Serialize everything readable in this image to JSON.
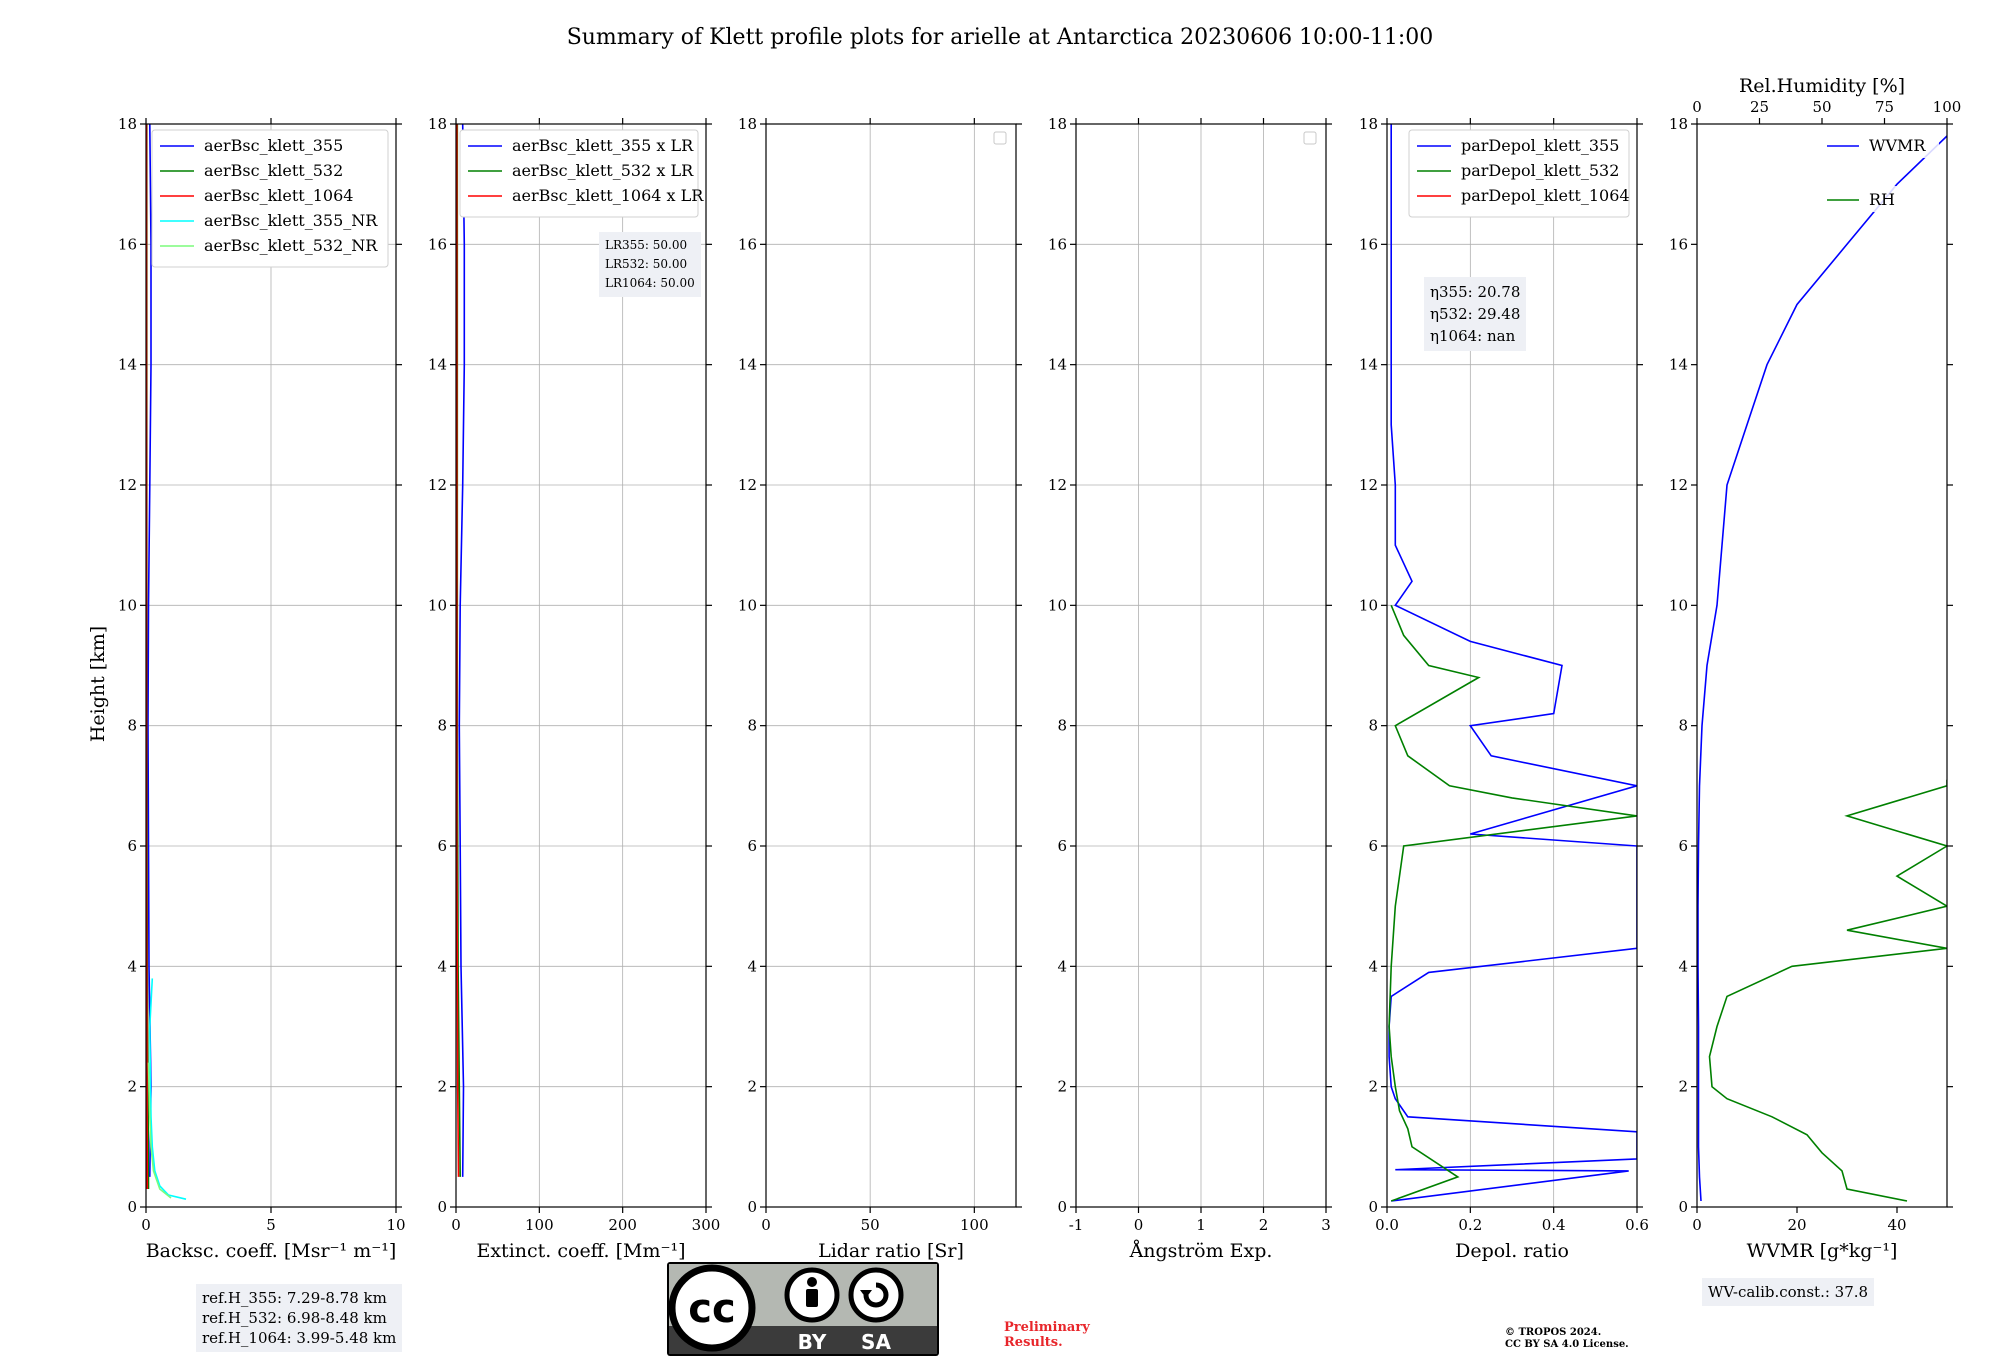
{
  "figure": {
    "title": "Summary of Klett profile plots for arielle at Antarctica 20230606 10:00-11:00",
    "ylabel": "Height [km]"
  },
  "colors": {
    "blue": "#0000ff",
    "green": "#008000",
    "red": "#ff0000",
    "cyan": "#00ffff",
    "lightgreen": "#7cfc7c",
    "box_bg": "#eef0f5"
  },
  "chart_data": [
    {
      "id": "backscatter",
      "type": "line",
      "xlabel": "Backsc. coeff. [Msr⁻¹ m⁻¹]",
      "xlim": [
        0,
        10
      ],
      "ylim": [
        0,
        18
      ],
      "xticks": [
        0,
        5,
        10
      ],
      "yticks": [
        0,
        2,
        4,
        6,
        8,
        10,
        12,
        14,
        16,
        18
      ],
      "grid": true,
      "legend": "top-right",
      "series": [
        {
          "name": "aerBsc_klett_355",
          "color": "blue",
          "y": [
            0.5,
            2,
            4,
            6,
            8,
            10,
            12,
            14,
            16,
            18
          ],
          "x": [
            0.15,
            0.2,
            0.12,
            0.1,
            0.08,
            0.1,
            0.15,
            0.2,
            0.2,
            0.15
          ]
        },
        {
          "name": "aerBsc_klett_532",
          "color": "green",
          "y": [
            0.3,
            2,
            4,
            6,
            8,
            10,
            12,
            14,
            16,
            18
          ],
          "x": [
            0.1,
            0.08,
            0.05,
            0.04,
            0.03,
            0.03,
            0.03,
            0.03,
            0.03,
            0.03
          ]
        },
        {
          "name": "aerBsc_klett_1064",
          "color": "red",
          "y": [
            0.3,
            2,
            4,
            6,
            8,
            10,
            12,
            14,
            16,
            18
          ],
          "x": [
            0.05,
            0.04,
            0.03,
            0.02,
            0.02,
            0.02,
            0.02,
            0.02,
            0.02,
            0.02
          ]
        },
        {
          "name": "aerBsc_klett_355_NR",
          "color": "cyan",
          "y": [
            0.13,
            0.2,
            0.35,
            0.6,
            1,
            1.5,
            2,
            3,
            3.8
          ],
          "x": [
            1.6,
            0.9,
            0.55,
            0.35,
            0.25,
            0.2,
            0.18,
            0.15,
            0.25
          ]
        },
        {
          "name": "aerBsc_klett_532_NR",
          "color": "lightgreen",
          "y": [
            0.15,
            0.3,
            0.6,
            1,
            1.5,
            2,
            2.4
          ],
          "x": [
            1.0,
            0.55,
            0.3,
            0.2,
            0.15,
            0.12,
            0.1
          ]
        }
      ],
      "annotation": [
        "ref.H_355: 7.29-8.78 km",
        "ref.H_532: 6.98-8.48 km",
        "ref.H_1064: 3.99-5.48 km"
      ]
    },
    {
      "id": "extinction",
      "type": "line",
      "xlabel": "Extinct. coeff. [Mm⁻¹]",
      "xlim": [
        0,
        300
      ],
      "ylim": [
        0,
        18
      ],
      "xticks": [
        0,
        100,
        200,
        300
      ],
      "yticks": [
        0,
        2,
        4,
        6,
        8,
        10,
        12,
        14,
        16,
        18
      ],
      "grid": true,
      "legend": "top-right",
      "series": [
        {
          "name": "aerBsc_klett_355 x LR",
          "color": "blue",
          "y": [
            0.5,
            2,
            4,
            6,
            8,
            10,
            12,
            14,
            16,
            18
          ],
          "x": [
            8,
            9,
            6,
            5,
            4,
            5,
            8,
            10,
            10,
            8
          ]
        },
        {
          "name": "aerBsc_klett_532 x LR",
          "color": "green",
          "y": [
            0.5,
            2,
            4,
            6,
            8,
            10,
            12,
            14,
            16,
            18
          ],
          "x": [
            5,
            4,
            2.5,
            2,
            1.5,
            1.5,
            1.5,
            1.5,
            1.5,
            1.5
          ]
        },
        {
          "name": "aerBsc_klett_1064 x LR",
          "color": "red",
          "y": [
            0.5,
            2,
            4,
            6,
            8,
            10,
            12,
            14,
            16,
            18
          ],
          "x": [
            3,
            2,
            1.5,
            1,
            1,
            1,
            1,
            1,
            1,
            1
          ]
        }
      ],
      "annotation": [
        "LR355: 50.00",
        "LR532: 50.00",
        "LR1064: 50.00"
      ]
    },
    {
      "id": "lidar-ratio",
      "type": "line",
      "xlabel": "Lidar ratio [Sr]",
      "xlim": [
        0,
        120
      ],
      "ylim": [
        0,
        18
      ],
      "xticks": [
        0,
        50,
        100
      ],
      "yticks": [
        0,
        2,
        4,
        6,
        8,
        10,
        12,
        14,
        16,
        18
      ],
      "grid": true,
      "legend": "top-right",
      "series": []
    },
    {
      "id": "angstrom",
      "type": "line",
      "xlabel": "Ångström Exp.",
      "xlim": [
        -1,
        3
      ],
      "ylim": [
        0,
        18
      ],
      "xticks": [
        -1,
        0,
        1,
        2,
        3
      ],
      "yticks": [
        0,
        2,
        4,
        6,
        8,
        10,
        12,
        14,
        16,
        18
      ],
      "grid": true,
      "legend": "top-right",
      "series": []
    },
    {
      "id": "depol",
      "type": "line",
      "xlabel": "Depol. ratio",
      "xlim": [
        0,
        0.6
      ],
      "ylim": [
        0,
        18
      ],
      "xticks": [
        0.0,
        0.2,
        0.4,
        0.6
      ],
      "yticks": [
        0,
        2,
        4,
        6,
        8,
        10,
        12,
        14,
        16,
        18
      ],
      "grid": true,
      "legend": "top-right",
      "series": [
        {
          "name": "parDepol_klett_355",
          "color": "blue",
          "y": [
            0.1,
            0.6,
            0.62,
            0.8,
            1.25,
            1.5,
            1.8,
            2,
            2.5,
            3,
            3.5,
            3.9,
            4.3,
            4.4,
            5,
            5.2,
            5.6,
            6,
            6.2,
            7,
            7.5,
            8,
            8.2,
            9,
            9.4,
            10,
            10.4,
            11,
            12,
            13,
            14,
            15,
            16,
            17,
            18
          ],
          "x": [
            0.01,
            0.58,
            0.02,
            0.6,
            0.6,
            0.05,
            0.02,
            0.01,
            0.005,
            0.005,
            0.01,
            0.1,
            0.6,
            0.6,
            0.6,
            0.6,
            0.6,
            0.6,
            0.2,
            0.6,
            0.25,
            0.2,
            0.4,
            0.42,
            0.2,
            0.02,
            0.06,
            0.02,
            0.02,
            0.01,
            0.01,
            0.01,
            0.01,
            0.01,
            0.01
          ]
        },
        {
          "name": "parDepol_klett_532",
          "color": "green",
          "y": [
            0.1,
            0.5,
            1.0,
            1.3,
            1.6,
            2,
            2.5,
            3,
            4,
            5,
            6,
            6.5,
            6.8,
            7,
            7.5,
            8,
            8.8,
            9,
            9.5,
            10
          ],
          "x": [
            0.01,
            0.17,
            0.06,
            0.05,
            0.03,
            0.02,
            0.01,
            0.005,
            0.01,
            0.02,
            0.04,
            0.6,
            0.3,
            0.15,
            0.05,
            0.02,
            0.22,
            0.1,
            0.04,
            0.01
          ]
        },
        {
          "name": "parDepol_klett_1064",
          "color": "red",
          "y": [],
          "x": []
        }
      ],
      "annotation": [
        "η355: 20.78",
        "η532: 29.48",
        "η1064: nan"
      ]
    },
    {
      "id": "wvmr",
      "type": "line",
      "xlabel": "WVMR [g*kg⁻¹]",
      "xlim": [
        0,
        50
      ],
      "ylim": [
        0,
        18
      ],
      "xticks": [
        0,
        20,
        40
      ],
      "yticks": [
        0,
        2,
        4,
        6,
        8,
        10,
        12,
        14,
        16,
        18
      ],
      "top_axis": {
        "label": "Rel.Humidity [%]",
        "xlim": [
          0,
          100
        ],
        "xticks": [
          0,
          25,
          50,
          75,
          100
        ]
      },
      "grid": false,
      "legend": "top-right",
      "series": [
        {
          "name": "WVMR",
          "color": "blue",
          "y": [
            0.1,
            0.5,
            1,
            2,
            3,
            4,
            5,
            6,
            7,
            8,
            9,
            10,
            11,
            12,
            13,
            14,
            15,
            16,
            17,
            17.8
          ],
          "x": [
            0.8,
            0.5,
            0.3,
            0.3,
            0.3,
            0.2,
            0.2,
            0.3,
            0.5,
            1,
            2,
            4,
            5,
            6,
            10,
            14,
            20,
            30,
            40,
            50
          ]
        },
        {
          "name": "RH",
          "color": "green",
          "y": [
            0.1,
            0.3,
            0.6,
            0.9,
            1.2,
            1.5,
            1.8,
            2,
            2.5,
            3,
            3.5,
            4,
            4.3,
            4.6,
            5,
            5.5,
            6,
            6.5,
            7,
            7.1
          ],
          "x": [
            84,
            60,
            58,
            50,
            44,
            30,
            12,
            6,
            5,
            8,
            12,
            38,
            100,
            60,
            100,
            80,
            100,
            60,
            100,
            100
          ]
        }
      ],
      "annotation": [
        "WV-calib.const.: 37.8"
      ]
    }
  ],
  "footer": {
    "cc_text": "cc",
    "by_label": "BY",
    "sa_label": "SA",
    "preliminary": "Preliminary\nResults.",
    "copyright": "© TROPOS 2024.\nCC BY SA 4.0 License."
  }
}
